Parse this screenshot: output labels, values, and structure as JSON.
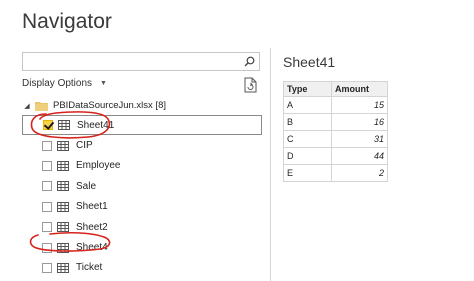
{
  "window": {
    "title": "Navigator"
  },
  "search": {
    "value": "",
    "placeholder": ""
  },
  "toolbar": {
    "display_options_label": "Display Options",
    "refresh_icon": "refresh-file-icon"
  },
  "tree": {
    "root": {
      "label": "PBIDataSourceJun.xlsx [8]",
      "expanded": true
    },
    "items": [
      {
        "label": "Sheet41",
        "checked": true,
        "selected": true
      },
      {
        "label": "CIP",
        "checked": false
      },
      {
        "label": "Employee",
        "checked": false
      },
      {
        "label": "Sale",
        "checked": false
      },
      {
        "label": "Sheet1",
        "checked": false
      },
      {
        "label": "Sheet2",
        "checked": false
      },
      {
        "label": "Sheet4",
        "checked": false
      },
      {
        "label": "Ticket",
        "checked": false
      }
    ]
  },
  "preview": {
    "title": "Sheet41",
    "columns": [
      "Type",
      "Amount"
    ],
    "rows": [
      [
        "A",
        "15"
      ],
      [
        "B",
        "16"
      ],
      [
        "C",
        "31"
      ],
      [
        "D",
        "44"
      ],
      [
        "E",
        "2"
      ]
    ]
  },
  "colors": {
    "annotation": "#d6231c",
    "checkbox_checked": "#f5d24a",
    "folder": "#e8c46a"
  }
}
